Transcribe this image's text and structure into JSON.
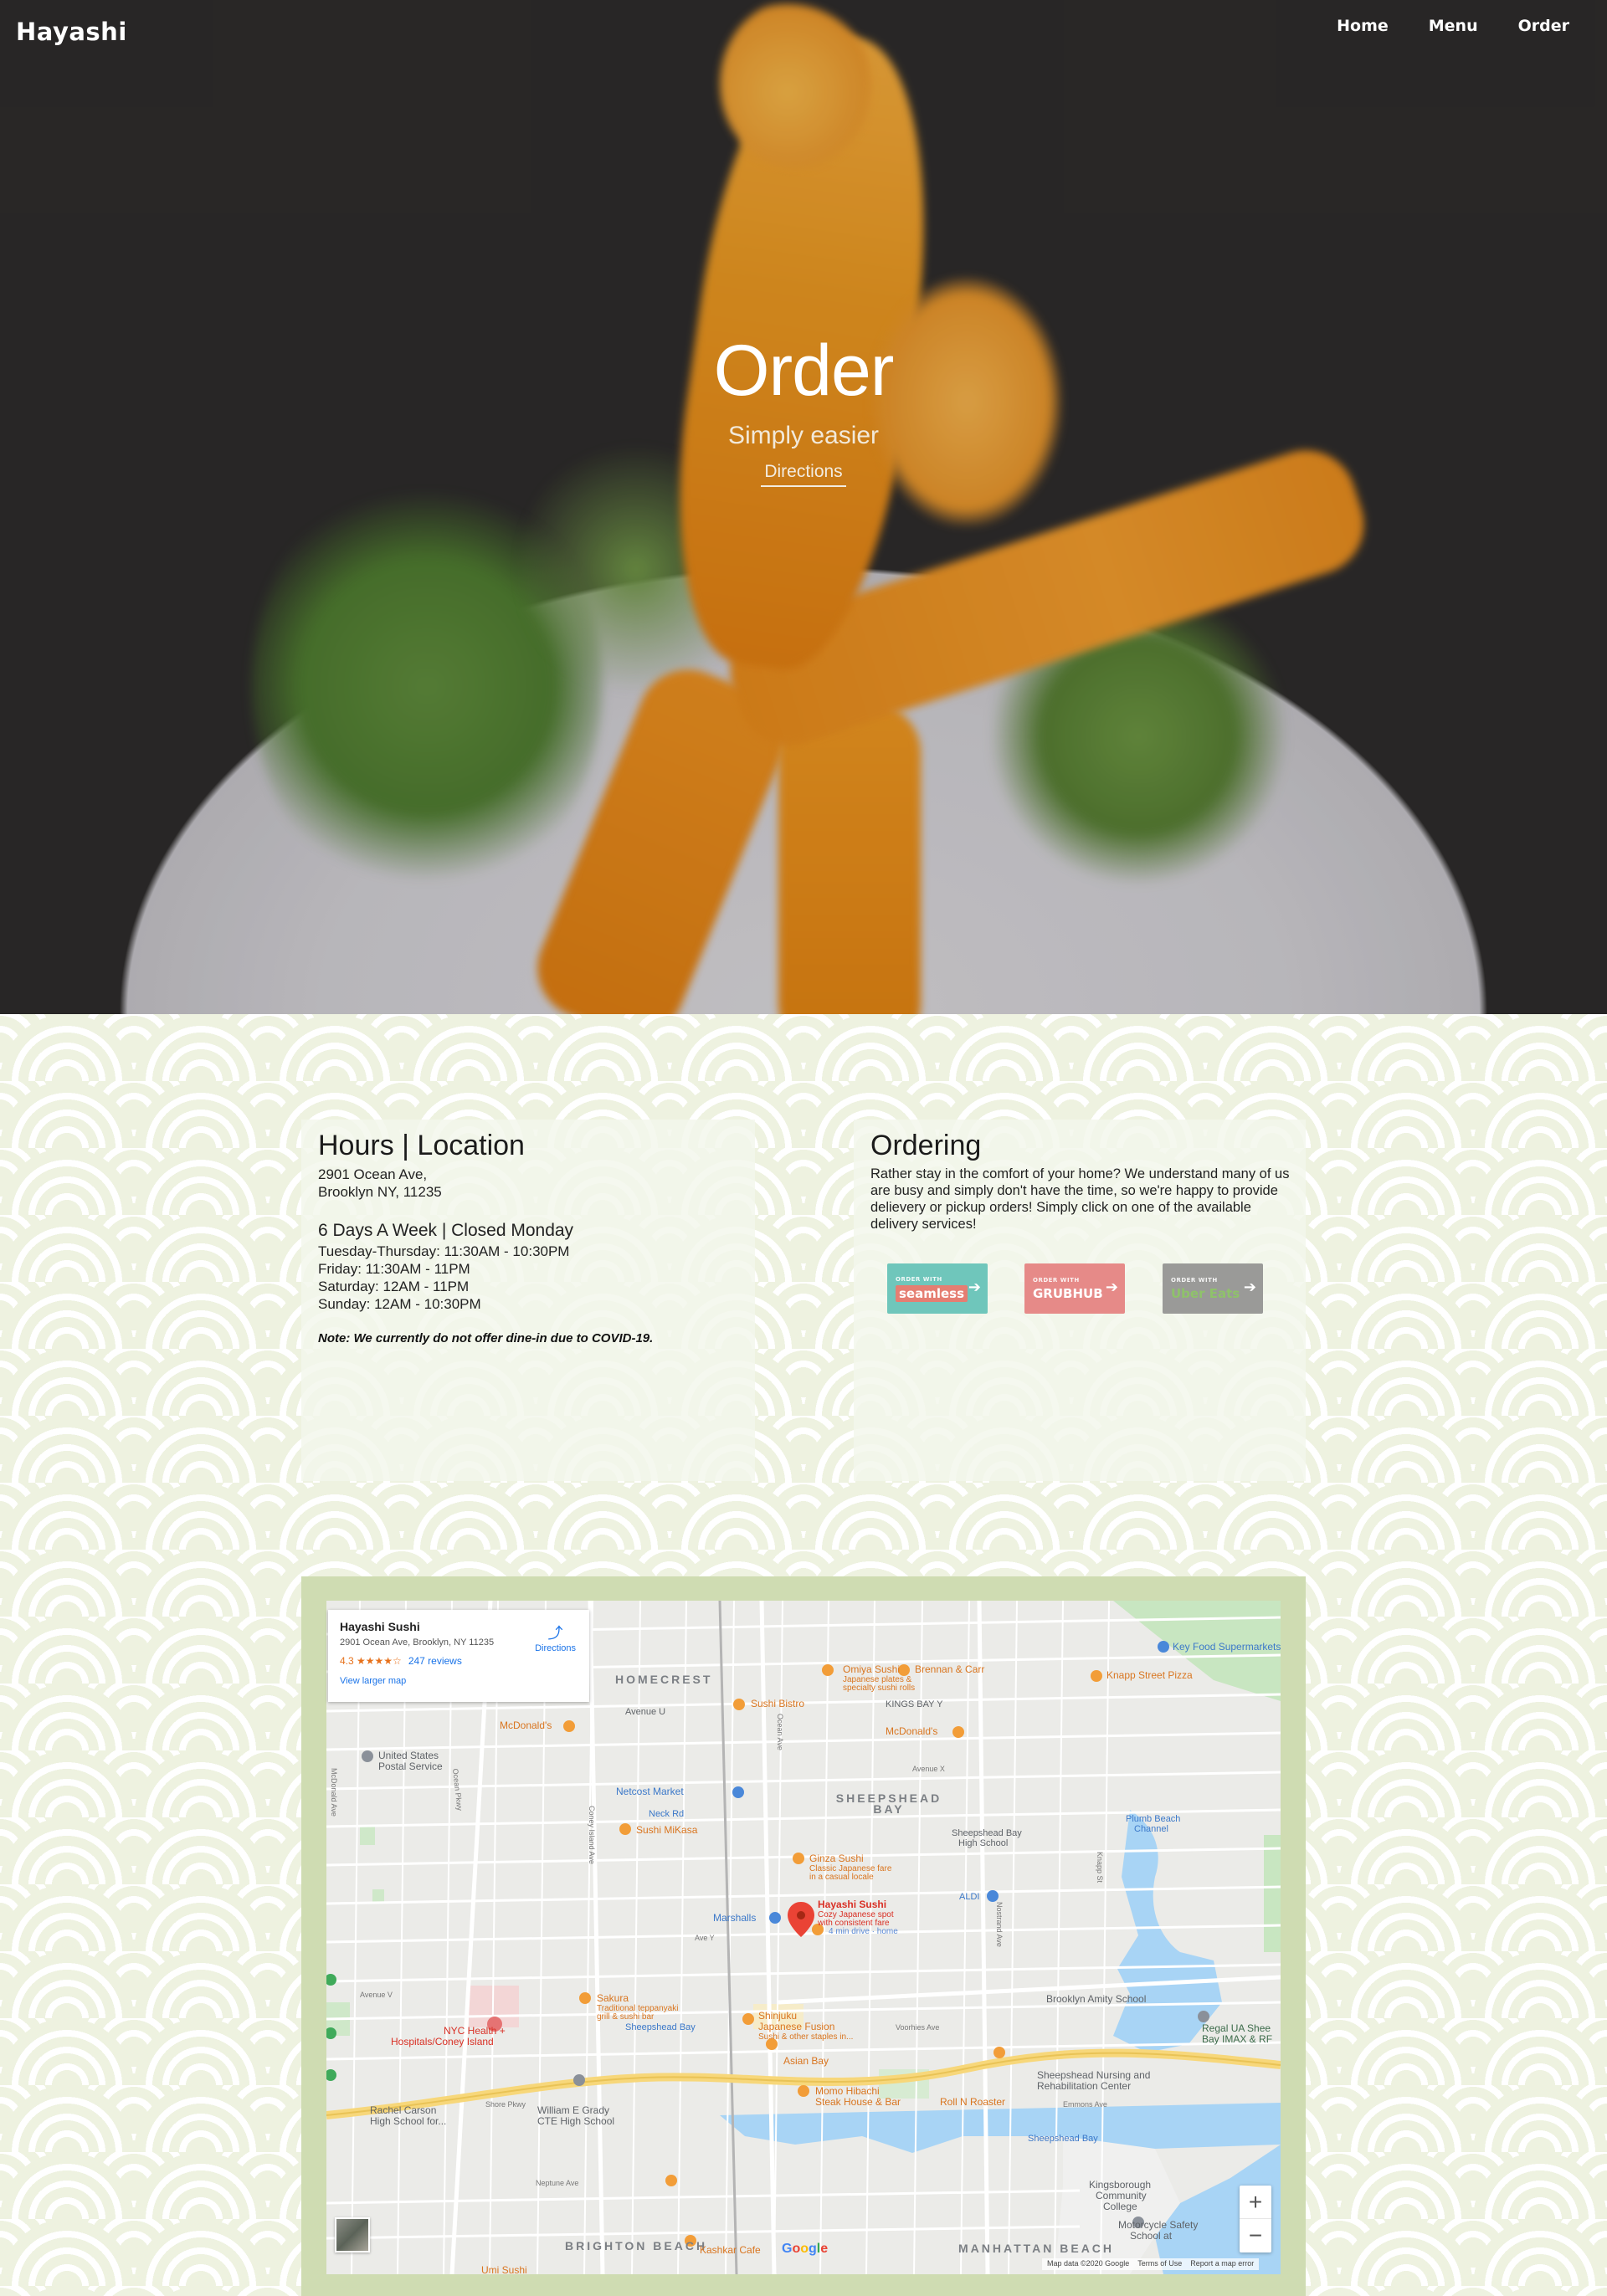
{
  "nav": {
    "brand": "Hayashi",
    "links": [
      "Home",
      "Menu",
      "Order"
    ]
  },
  "hero": {
    "title": "Order",
    "subtitle": "Simply easier",
    "directions_link": "Directions"
  },
  "hours": {
    "title": "Hours | Location",
    "address_line1": "2901 Ocean Ave,",
    "address_line2": "Brooklyn NY, 11235",
    "schedule_title": "6 Days A Week | Closed Monday",
    "schedule": [
      "Tuesday-Thursday: 11:30AM - 10:30PM",
      "Friday: 11:30AM - 11PM",
      "Saturday: 12AM - 11PM",
      "Sunday: 12AM - 10:30PM"
    ],
    "note": "Note: We currently do not offer dine-in due to COVID-19."
  },
  "ordering": {
    "title": "Ordering",
    "body": "Rather stay in the comfort of your home? We understand many of us are busy and simply don't have the time, so we're happy to provide delievery or pickup orders! Simply click on one of the available delivery services!",
    "services": [
      {
        "tag": "ORDER WITH",
        "name": "seamless",
        "color": "#6fc6bb"
      },
      {
        "tag": "ORDER WITH",
        "name": "GRUBHUB",
        "color": "#e68a88"
      },
      {
        "tag": "ORDER WITH",
        "name": "Uber Eats",
        "color": "#9a9a98"
      }
    ]
  },
  "map": {
    "card": {
      "name": "Hayashi Sushi",
      "address": "2901 Ocean Ave, Brooklyn, NY 11235",
      "rating": "4.3 ★★★★☆",
      "reviews": "247 reviews",
      "larger_map": "View larger map",
      "directions": "Directions"
    },
    "areas": [
      "HOMECREST",
      "SHEEPSHEAD BAY",
      "BRIGHTON BEACH",
      "MANHATTAN BEACH",
      "Sheepshead Bay"
    ],
    "places": {
      "key_food": "Key Food Supermarkets",
      "omiya": "Omiya Sushi",
      "omiya_desc1": "Japanese plates &",
      "omiya_desc2": "specialty sushi rolls",
      "brennan": "Brennan & Carr",
      "knapp": "Knapp Street Pizza",
      "kings_bay": "KINGS BAY Y",
      "sushi_bistro": "Sushi Bistro",
      "avenue_u": "Avenue U",
      "mcdonalds1": "McDonald's",
      "mcdonalds2": "McDonald's",
      "post_office1": "United States",
      "post_office2": "Postal Service",
      "netcost": "Netcost Market",
      "neck_rd": "Neck Rd",
      "sushi_mikasa": "Sushi MiKasa",
      "ginza": "Ginza Sushi",
      "ginza_desc1": "Classic Japanese fare",
      "ginza_desc2": "in a casual locale",
      "sheepshead_hs1": "Sheepshead Bay",
      "sheepshead_hs2": "High School",
      "plumb1": "Plumb Beach",
      "plumb2": "Channel",
      "hayashi": "Hayashi Sushi",
      "hayashi_desc1": "Cozy Japanese spot",
      "hayashi_desc2": "with consistent fare",
      "hayashi_desc3": "4 min drive · home",
      "marshalls": "Marshalls",
      "aldi": "ALDI",
      "sakura": "Sakura",
      "sakura_desc": "Traditional teppanyaki grill & sushi bar",
      "shinjuku1": "Shinjuku",
      "shinjuku2": "Japanese Fusion",
      "shinjuku_desc": "Sushi & other staples in...",
      "sheepshead_station": "Sheepshead Bay",
      "amity": "Brooklyn Amity School",
      "regal1": "Regal UA Shee",
      "regal2": "Bay IMAX & RF",
      "nyc_health1": "NYC Health +",
      "nyc_health2": "Hospitals/Coney Island",
      "asian_bay": "Asian Bay",
      "nursing1": "Sheepshead Nursing and",
      "nursing2": "Rehabilitation Center",
      "momo1": "Momo Hibachi",
      "momo2": "Steak House & Bar",
      "roll_n_roaster": "Roll N Roaster",
      "rachel1": "Rachel Carson",
      "rachel2": "High School for...",
      "grady1": "William E Grady",
      "grady2": "CTE High School",
      "kingsborough1": "Kingsborough",
      "kingsborough2": "Community",
      "kingsborough3": "College",
      "motorcycle1": "Motorcycle Safety",
      "motorcycle2": "School at",
      "kashkar": "Kashkar Cafe",
      "umi": "Umi Sushi"
    },
    "streets": {
      "shore_pkwy": "Shore Pkwy",
      "voorhies": "Voorhies Ave",
      "emmons": "Emmons Ave",
      "ocean_pkwy": "Ocean Pkwy",
      "coney_island": "Coney Island Ave",
      "ocean_ave": "Ocean Ave",
      "nostrand": "Nostrand Ave",
      "avenue_y": "Ave Y",
      "avenue_v": "Avenue V",
      "neptune": "Neptune Ave",
      "knapp_st": "Knapp St",
      "mcdonald_ave": "McDonald Ave",
      "avenue_u_st": "Avenue U",
      "avenue_x": "Avenue X"
    },
    "zoom_in": "+",
    "zoom_out": "−",
    "google": [
      "G",
      "o",
      "o",
      "g",
      "l",
      "e"
    ],
    "footer": [
      "Map data ©2020 Google",
      "Terms of Use",
      "Report a map error"
    ]
  },
  "colors": {
    "pattern_bg": "#eef2e0",
    "map_frame": "#cfdcb2",
    "accent": "#ffffff"
  }
}
